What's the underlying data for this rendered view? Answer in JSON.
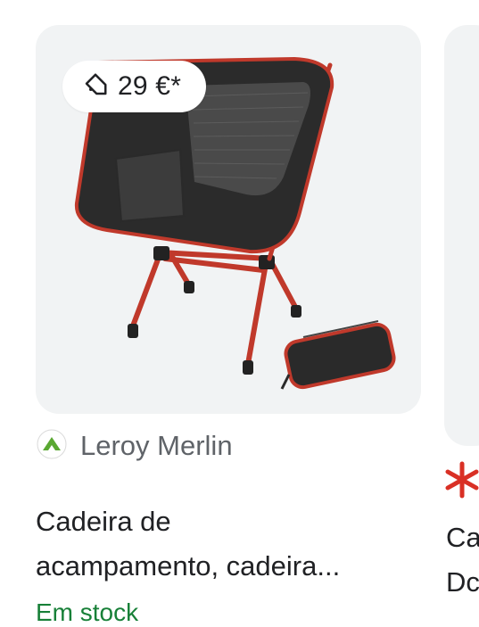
{
  "card": {
    "price": "29 €*",
    "price_icon": "price-tag-icon",
    "image_alt": "folding camping chair with carry bag",
    "merchant": {
      "name": "Leroy Merlin",
      "logo_icon": "leroy-merlin-logo-icon"
    },
    "title_line_1": "Cadeira de",
    "title_line_2": "acampamento, cadeira...",
    "stock_status": "Em stock",
    "colors": {
      "stock": "#188038",
      "accent": "#d93025",
      "frame": "#c0392b"
    }
  },
  "next_card": {
    "badge_icon": "asterisk-icon",
    "title_line_1": "Ca",
    "title_line_2": "Dc"
  }
}
